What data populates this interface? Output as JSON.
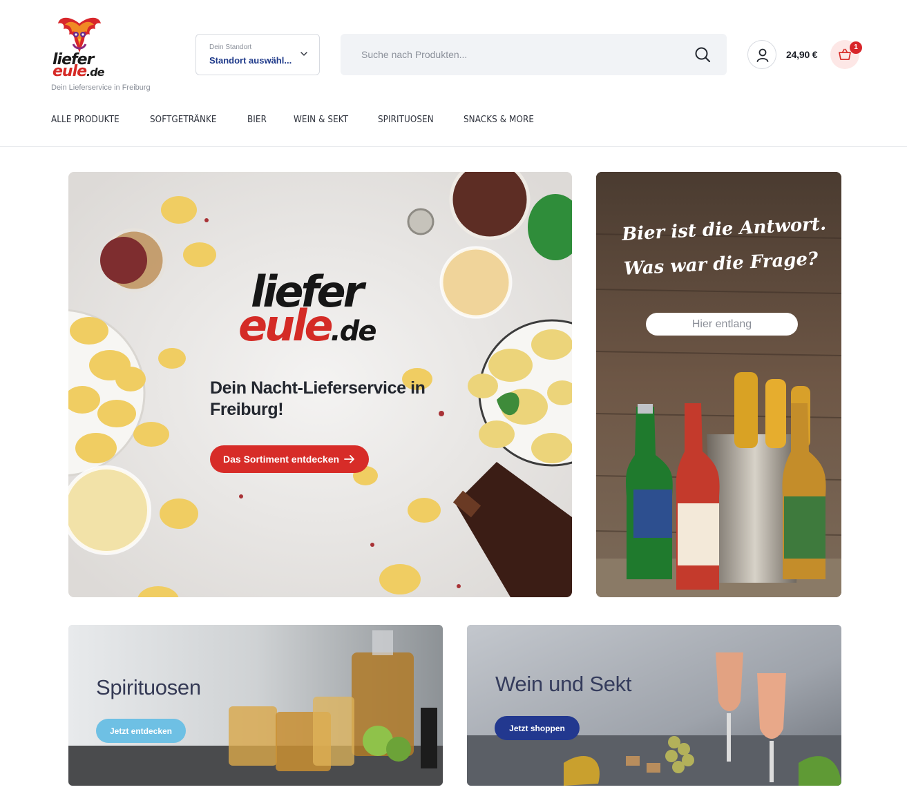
{
  "header": {
    "logo": {
      "word_line1": "liefer",
      "word_line2": "eule",
      "word_suffix": ".de",
      "tagline": "Dein Lieferservice in Freiburg"
    },
    "location": {
      "label": "Dein Standort",
      "value": "Standort auswähl..."
    },
    "search": {
      "placeholder": "Suche nach Produkten..."
    },
    "cart": {
      "total": "24,90 €",
      "count": "1"
    },
    "icons": {
      "location_chevron": "chevron-down-icon",
      "search": "search-icon",
      "account": "user-icon",
      "cart": "basket-icon"
    }
  },
  "nav": {
    "items": [
      "ALLE PRODUKTE",
      "SOFTGETRÄNKE",
      "BIER",
      "WEIN & SEKT",
      "SPIRITUOSEN",
      "SNACKS & MORE"
    ]
  },
  "hero": {
    "logo_line1": "liefer",
    "logo_line2": "eule",
    "logo_suffix": ".de",
    "title": "Dein Nacht-Lieferservice in Freiburg!",
    "cta": "Das Sortiment entdecken"
  },
  "side_banner": {
    "quote_line1": "Bier ist die Antwort.",
    "quote_line2": "Was war die Frage?",
    "cta": "Hier entlang"
  },
  "tiles": [
    {
      "title": "Spirituosen",
      "cta": "Jetzt entdecken"
    },
    {
      "title": "Wein und Sekt",
      "cta": "Jetzt shoppen"
    }
  ],
  "colors": {
    "brand_red": "#d72c28",
    "brand_blue": "#22388f",
    "light_blue": "#6ec0e4",
    "text_dark": "#23272f"
  }
}
